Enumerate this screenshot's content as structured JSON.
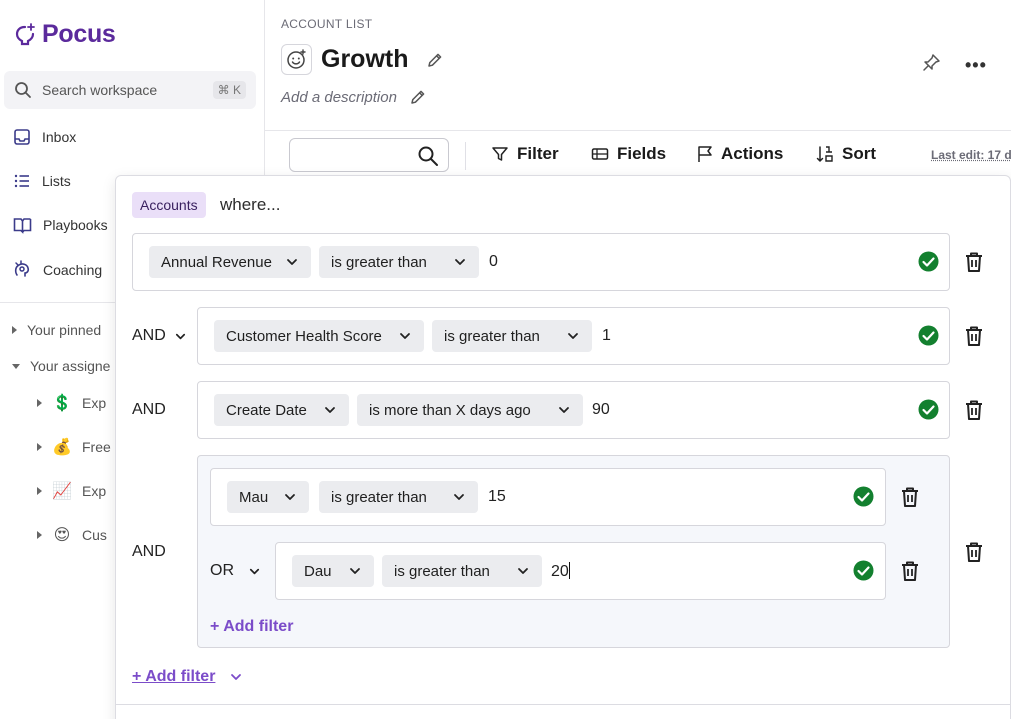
{
  "sidebar": {
    "brand": "Pocus",
    "search": {
      "label": "Search workspace",
      "shortcut": "⌘ K"
    },
    "nav": [
      {
        "label": "Inbox",
        "icon": "inbox-icon"
      },
      {
        "label": "Lists",
        "icon": "list-icon"
      },
      {
        "label": "Playbooks",
        "icon": "book-icon"
      },
      {
        "label": "Coaching",
        "icon": "coaching-icon"
      }
    ],
    "tree": [
      {
        "label": "Your pinned",
        "expanded": false
      },
      {
        "label": "Your assigne",
        "expanded": true
      }
    ],
    "subtree": [
      {
        "emoji": "💲",
        "label": "Exp"
      },
      {
        "emoji": "💰",
        "label": "Free"
      },
      {
        "emoji": "📈",
        "label": "Exp"
      },
      {
        "emoji": "😍",
        "label": "Cus"
      }
    ]
  },
  "header": {
    "breadcrumb": "ACCOUNT LIST",
    "title": "Growth",
    "description_placeholder": "Add a description",
    "more": "•••"
  },
  "toolbar": {
    "search_value": "",
    "filter": "Filter",
    "fields": "Fields",
    "actions": "Actions",
    "sort": "Sort",
    "last_edit": "Last edit: 17 d"
  },
  "filter_popup": {
    "object_tag": "Accounts",
    "where": "where...",
    "rows": [
      {
        "field": "Annual Revenue",
        "operator": "is greater than",
        "value": "0"
      },
      {
        "conjunction": "AND",
        "field": "Customer Health Score",
        "operator": "is greater than",
        "value": "1"
      },
      {
        "conjunction": "AND",
        "field": "Create Date",
        "operator": "is more than X days ago",
        "value": "90"
      }
    ],
    "group": {
      "conjunction": "AND",
      "rows": [
        {
          "field": "Mau",
          "operator": "is greater than",
          "value": "15"
        },
        {
          "conjunction": "OR",
          "field": "Dau",
          "operator": "is greater than",
          "value": "20"
        }
      ],
      "add_filter": "+ Add filter"
    },
    "add_filter": "+ Add filter"
  },
  "colors": {
    "brand": "#5b2a9c",
    "accent": "#7b4cc9",
    "success": "#13802f",
    "tag_bg": "#eadff8"
  }
}
